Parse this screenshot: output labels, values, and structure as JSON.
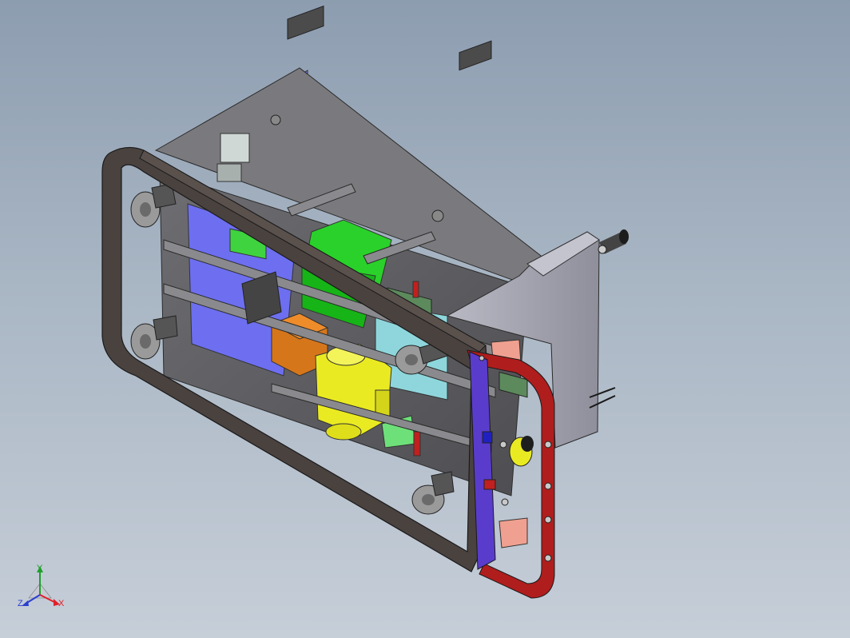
{
  "viewport": {
    "background_top": "#8d9db0",
    "background_bottom": "#c6ced8"
  },
  "triad": {
    "x_label": "X",
    "y_label": "Y",
    "z_label": "Z",
    "x_color": "#e0202a",
    "y_color": "#1fa02a",
    "z_color": "#2a3fd0"
  },
  "model": {
    "frame_color": "#4a423f",
    "front_frame_color": "#b01d1d",
    "panel_blue": "#6d6ff0",
    "panel_green": "#2ad12a",
    "panel_cyan": "#8ed6dc",
    "block_orange": "#d6761a",
    "motor_yellow": "#eaea22",
    "housing_grey": "#9c9ca6"
  }
}
